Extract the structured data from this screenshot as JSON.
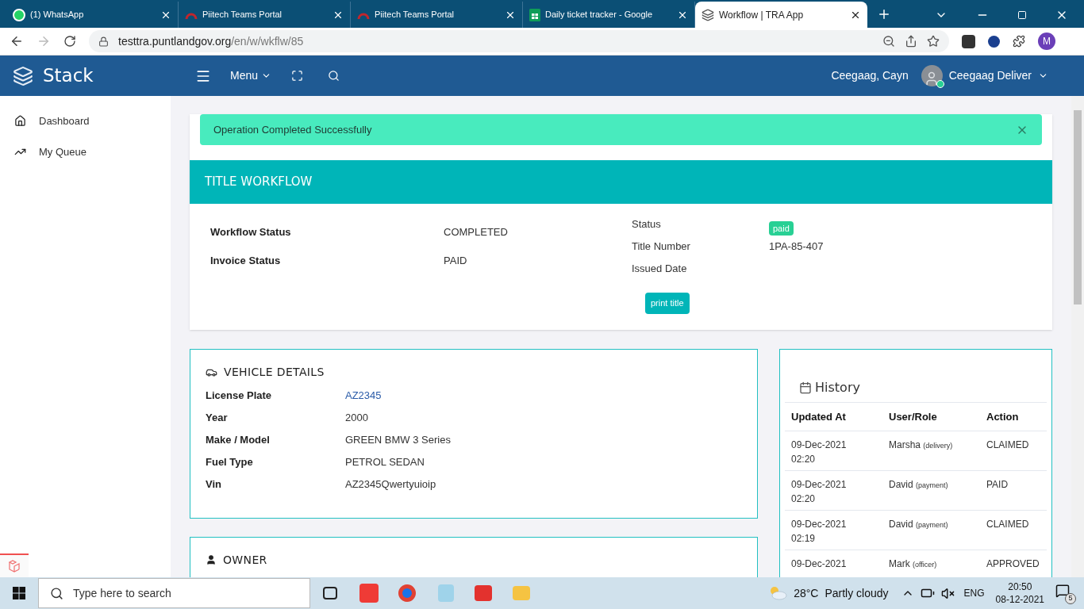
{
  "browser": {
    "tabs": [
      {
        "title": "(1) WhatsApp",
        "kind": "whatsapp",
        "selected": false
      },
      {
        "title": "Piitech Teams Portal",
        "kind": "arc",
        "selected": false
      },
      {
        "title": "Piitech Teams Portal",
        "kind": "arc",
        "selected": false
      },
      {
        "title": "Daily ticket tracker - Google",
        "kind": "sheets",
        "selected": false
      },
      {
        "title": "Workflow | TRA App",
        "kind": "stack",
        "selected": true
      }
    ],
    "url_host": "testtra.puntlandgov.org",
    "url_path": "/en/w/wkflw/85",
    "profile": "M"
  },
  "header": {
    "brand": "Stack",
    "menu": "Menu",
    "user_name": "Ceegaag, Cayn",
    "account": "Ceegaag Deliver"
  },
  "sidebar": {
    "items": [
      {
        "label": "Dashboard",
        "kind": "home"
      },
      {
        "label": "My Queue",
        "kind": "trend"
      }
    ]
  },
  "alert": {
    "text": "Operation Completed Successfully"
  },
  "workflow": {
    "heading": "TITLE WORKFLOW",
    "left": [
      {
        "label": "Workflow Status",
        "value": "COMPLETED"
      },
      {
        "label": "Invoice Status",
        "value": "PAID"
      }
    ],
    "right": [
      {
        "label": "Status",
        "value": "paid",
        "kind": "badge"
      },
      {
        "label": "Title Number",
        "value": "1PA-85-407",
        "kind": "text"
      },
      {
        "label": "Issued Date"
      }
    ],
    "button": "print title"
  },
  "vehicle": {
    "heading": "VEHICLE DETAILS",
    "rows": [
      {
        "label": "License Plate",
        "value": "AZ2345",
        "kind": "link"
      },
      {
        "label": "Year",
        "value": "2000",
        "kind": "text"
      },
      {
        "label": "Make / Model",
        "value": "GREEN BMW 3 Series",
        "kind": "text"
      },
      {
        "label": "Fuel Type",
        "value": "PETROL SEDAN",
        "kind": "text"
      },
      {
        "label": "Vin",
        "value": "AZ2345Qwertyuioip",
        "kind": "text"
      }
    ]
  },
  "history": {
    "title": "History",
    "columns": [
      "Updated At",
      "User/Role",
      "Action"
    ],
    "rows": [
      {
        "date": "09-Dec-2021",
        "time": "02:20",
        "user": "Marsha",
        "role": "(delivery)",
        "action": "CLAIMED"
      },
      {
        "date": "09-Dec-2021",
        "time": "02:20",
        "user": "David",
        "role": "(payment)",
        "action": "PAID"
      },
      {
        "date": "09-Dec-2021",
        "time": "02:19",
        "user": "David",
        "role": "(payment)",
        "action": "CLAIMED"
      },
      {
        "date": "09-Dec-2021",
        "user": "Mark",
        "role": "(officer)",
        "action": "APPROVED"
      }
    ]
  },
  "owner": {
    "heading": "OWNER"
  },
  "taskbar": {
    "search_placeholder": "Type here to search",
    "temperature": "28°C",
    "weather": "Partly cloudy",
    "language": "ENG",
    "time": "20:50",
    "date": "08-12-2021",
    "notifications": "5"
  }
}
